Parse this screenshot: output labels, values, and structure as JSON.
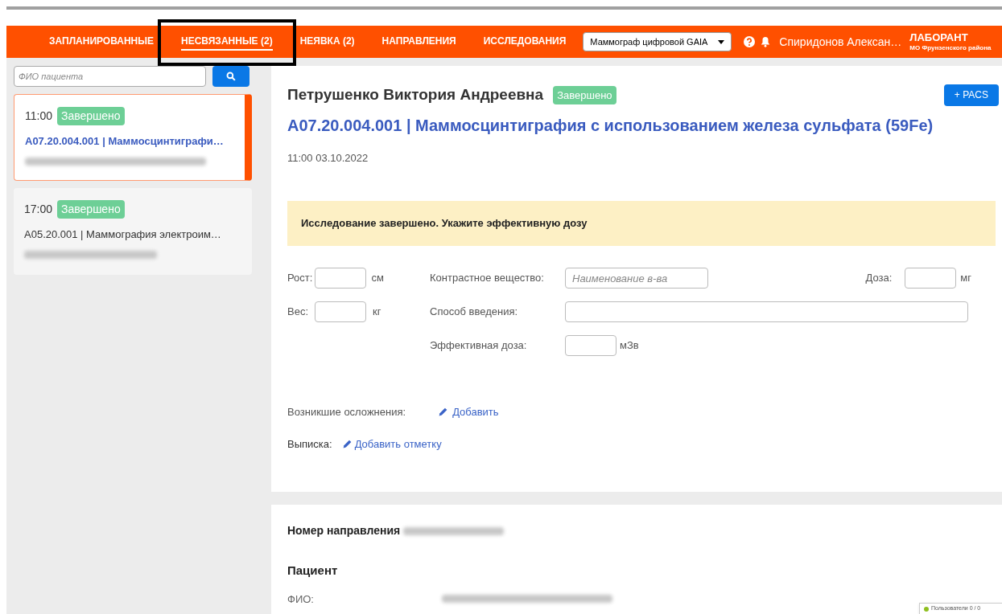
{
  "nav": {
    "tabs": [
      {
        "label": "ЗАПЛАНИРОВАННЫЕ",
        "selected": false,
        "highlighted": false
      },
      {
        "label": "НЕСВЯЗАННЫЕ (2)",
        "selected": true,
        "highlighted": true
      },
      {
        "label": "НЕЯВКА (2)",
        "selected": false,
        "highlighted": false
      },
      {
        "label": "НАПРАВЛЕНИЯ",
        "selected": false,
        "highlighted": false
      },
      {
        "label": "ИССЛЕДОВАНИЯ",
        "selected": false,
        "highlighted": false
      }
    ],
    "device_select": {
      "value": "Маммограф цифровой GAIA"
    },
    "user": {
      "name": "Спиридонов Алексан…",
      "role": "ЛАБОРАНТ",
      "org": "МО Фрунзенского района"
    }
  },
  "search": {
    "placeholder": "ФИО пациента"
  },
  "appointments": [
    {
      "time": "11:00",
      "status": "Завершено",
      "title": "A07.20.004.001 | Маммосцинтиграфи…",
      "selected": true
    },
    {
      "time": "17:00",
      "status": "Завершено",
      "title": "A05.20.001 | Маммография электроим…",
      "selected": false
    }
  ],
  "detail": {
    "patient": "Петрушенко Виктория Андреевна",
    "status": "Завершено",
    "pacs_button": "+ PACS",
    "title": "A07.20.004.001 | Маммосцинтиграфия с использованием железа сульфата (59Fe)",
    "datetime": "11:00 03.10.2022",
    "alert": "Исследование завершено. Укажите эффективную дозу",
    "form": {
      "height": {
        "label": "Рост:",
        "unit": "см"
      },
      "weight": {
        "label": "Вес:",
        "unit": "кг"
      },
      "contrast": {
        "label": "Контрастное вещество:",
        "placeholder": "Наименование в-ва"
      },
      "dose": {
        "label": "Доза:",
        "unit": "мг"
      },
      "route": {
        "label": "Способ введения:"
      },
      "effective_dose": {
        "label": "Эффективная доза:",
        "unit": "мЗв"
      }
    },
    "complications": {
      "label": "Возникшие осложнения:",
      "action": "Добавить"
    },
    "extract": {
      "label": "Выписка:",
      "action": "Добавить отметку"
    }
  },
  "referral": {
    "label": "Номер направления",
    "section": "Пациент",
    "fio_label": "ФИО:"
  },
  "status_widget": {
    "label": "Пользователи 0 / 0",
    "color": "#8fbf1f"
  }
}
